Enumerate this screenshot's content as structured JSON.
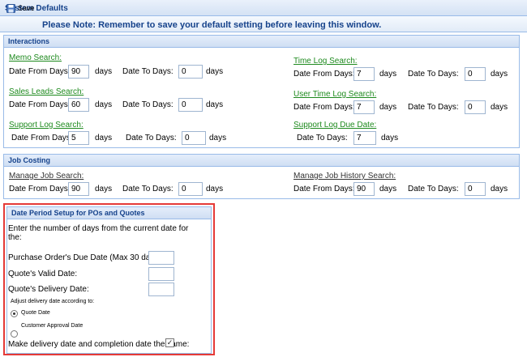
{
  "window": {
    "title": "System Defaults"
  },
  "toolbar": {
    "save_label": "Save",
    "note": "Please Note: Remember to save your default setting before leaving this window."
  },
  "interactions": {
    "title": "Interactions",
    "memo": {
      "label": "Memo Search:",
      "from_label": "Date From Days:",
      "from": "90",
      "to_label": "Date To Days:",
      "to": "0",
      "unit": "days"
    },
    "sales": {
      "label": "Sales Leads Search:",
      "from_label": "Date From Days:",
      "from": "60",
      "to_label": "Date To Days:",
      "to": "0",
      "unit": "days"
    },
    "support": {
      "label": "Support Log Search:",
      "from_label": "Date From Days:",
      "from": "5",
      "to_label": "Date To Days:",
      "to": "0",
      "unit": "days"
    },
    "timelog": {
      "label": "Time Log Search:",
      "from_label": "Date From Days:",
      "from": "7",
      "to_label": "Date To Days:",
      "to": "0",
      "unit": "days"
    },
    "usertime": {
      "label": "User Time Log Search:",
      "from_label": "Date From Days:",
      "from": "7",
      "to_label": "Date To Days:",
      "to": "0",
      "unit": "days"
    },
    "supportdue": {
      "label": "Support Log Due Date:",
      "to_label": "Date To Days:",
      "to": "7",
      "unit": "days"
    }
  },
  "job_costing": {
    "title": "Job Costing",
    "job": {
      "label": "Manage Job Search:",
      "from_label": "Date From Days:",
      "from": "90",
      "to_label": "Date To Days:",
      "to": "0",
      "unit": "days"
    },
    "history": {
      "label": "Manage Job History Search:",
      "from_label": "Date From Days:",
      "from": "90",
      "to_label": "Date To Days:",
      "to": "0",
      "unit": "days"
    }
  },
  "date_period": {
    "title": "Date Period Setup for POs and Quotes",
    "intro_line1": "Enter the number of days from the current date for",
    "intro_line2": "the:",
    "po_label": "Purchase Order's Due Date (Max 30 days):",
    "po_value": "",
    "valid_label": "Quote's Valid Date:",
    "valid_value": "",
    "delivery_label": "Quote's Delivery Date:",
    "delivery_value": "",
    "adjust_label": "Adjust delivery date according to:",
    "radio_quote": "Quote Date",
    "radio_customer": "Customer Approval Date",
    "same_label": "Make delivery date and completion date the same:",
    "same_checked": "✓"
  }
}
